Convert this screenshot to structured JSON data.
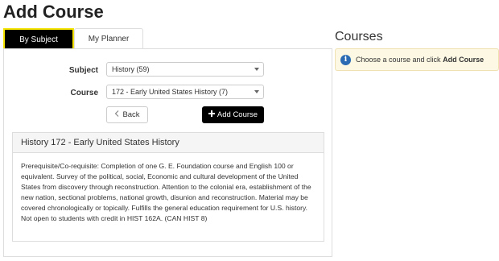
{
  "page": {
    "title": "Add Course"
  },
  "tabs": [
    {
      "label": "By Subject",
      "active": true
    },
    {
      "label": "My Planner",
      "active": false
    }
  ],
  "form": {
    "subject_label": "Subject",
    "subject_value": "History (59)",
    "course_label": "Course",
    "course_value": "172 - Early United States History (7)",
    "back_label": "Back",
    "back_icon": "chevron-left-icon",
    "add_label": "Add Course",
    "add_icon": "plus-icon"
  },
  "course_detail": {
    "heading": "History 172 - Early United States History",
    "description": "Prerequisite/Co-requisite: Completion of one G. E. Foundation course and English 100 or equivalent. Survey of the political, social, Economic and cultural development of the United States from discovery through reconstruction. Attention to the colonial era, establishment of the new nation, sectional problems, national growth, disunion and reconstruction. Material may be covered chronologically or topically. Fulfills the general education requirement for U.S. history. Not open to students with credit in HIST 162A. (CAN HIST 8)"
  },
  "courses": {
    "title": "Courses",
    "info_prefix": "Choose a course and click",
    "info_emphasis": "Add Course",
    "info_icon": "info-icon"
  },
  "colors": {
    "active_tab_bg": "#000000",
    "active_tab_border": "#f4e300",
    "primary_button": "#000000",
    "info_bg": "#fcf8e3",
    "info_icon": "#2a6bb3"
  }
}
